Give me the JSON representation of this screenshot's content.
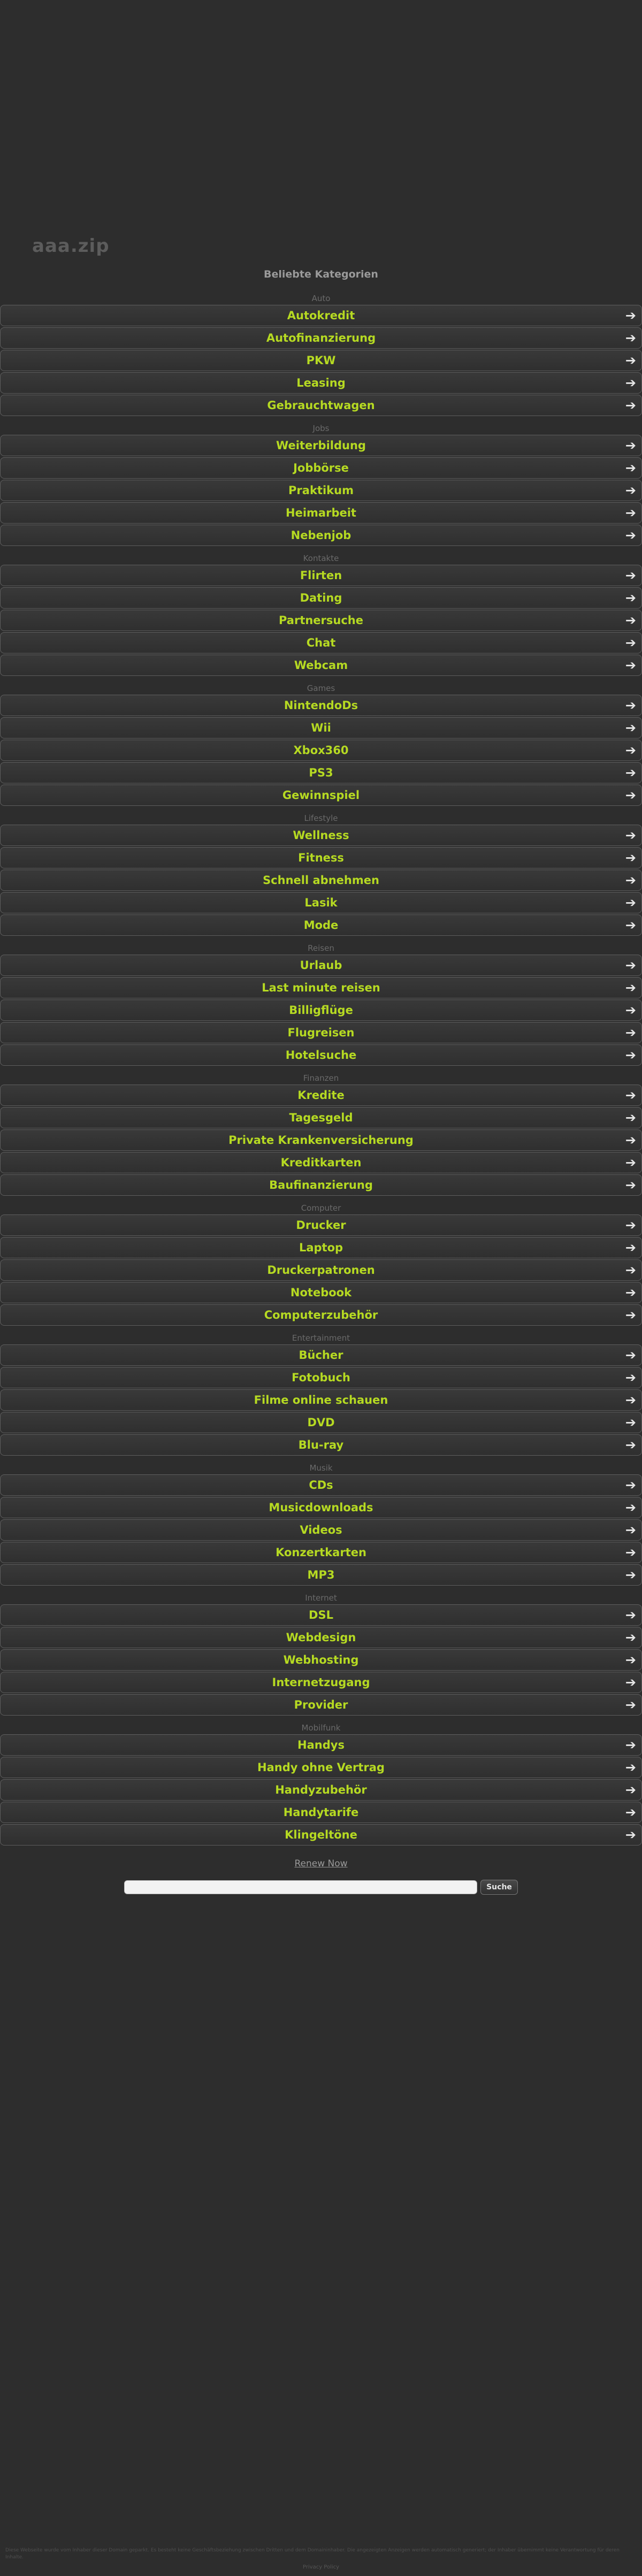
{
  "domain": "aaa.zip",
  "popular_heading": "Beliebte Kategorien",
  "categories": [
    {
      "title": "Auto",
      "links": [
        "Autokredit",
        "Autofinanzierung",
        "PKW",
        "Leasing",
        "Gebrauchtwagen"
      ]
    },
    {
      "title": "Jobs",
      "links": [
        "Weiterbildung",
        "Jobbörse",
        "Praktikum",
        "Heimarbeit",
        "Nebenjob"
      ]
    },
    {
      "title": "Kontakte",
      "links": [
        "Flirten",
        "Dating",
        "Partnersuche",
        "Chat",
        "Webcam"
      ]
    },
    {
      "title": "Games",
      "links": [
        "NintendoDs",
        "Wii",
        "Xbox360",
        "PS3",
        "Gewinnspiel"
      ]
    },
    {
      "title": "Lifestyle",
      "links": [
        "Wellness",
        "Fitness",
        "Schnell abnehmen",
        "Lasik",
        "Mode"
      ]
    },
    {
      "title": "Reisen",
      "links": [
        "Urlaub",
        "Last minute reisen",
        "Billigflüge",
        "Flugreisen",
        "Hotelsuche"
      ]
    },
    {
      "title": "Finanzen",
      "links": [
        "Kredite",
        "Tagesgeld",
        "Private Krankenversicherung",
        "Kreditkarten",
        "Baufinanzierung"
      ]
    },
    {
      "title": "Computer",
      "links": [
        "Drucker",
        "Laptop",
        "Druckerpatronen",
        "Notebook",
        "Computerzubehör"
      ]
    },
    {
      "title": "Entertainment",
      "links": [
        "Bücher",
        "Fotobuch",
        "Filme online schauen",
        "DVD",
        "Blu-ray"
      ]
    },
    {
      "title": "Musik",
      "links": [
        "CDs",
        "Musicdownloads",
        "Videos",
        "Konzertkarten",
        "MP3"
      ]
    },
    {
      "title": "Internet",
      "links": [
        "DSL",
        "Webdesign",
        "Webhosting",
        "Internetzugang",
        "Provider"
      ]
    },
    {
      "title": "Mobilfunk",
      "links": [
        "Handys",
        "Handy ohne Vertrag",
        "Handyzubehör",
        "Handytarife",
        "Klingeltöne"
      ]
    }
  ],
  "arrow_icon": "➔",
  "renew_link": "Renew Now",
  "search": {
    "value": "",
    "placeholder": "",
    "button_label": "Suche"
  },
  "footer": {
    "disclaimer": "Diese Webseite wurde vom Inhaber dieser Domain geparkt. Es besteht keine Geschäftsbeziehung zwischen Dritten und dem Domaininhaber. Die angezeigten Anzeigen werden automatisch generiert; der Inhaber übernimmt keine Verantwortung für deren Inhalte.",
    "privacy_link": "Privacy Policy"
  },
  "colors": {
    "background": "#2d2d2d",
    "link_text": "#b6da22",
    "category_title": "#6a6a6a",
    "domain_title": "#5c5c5c"
  }
}
